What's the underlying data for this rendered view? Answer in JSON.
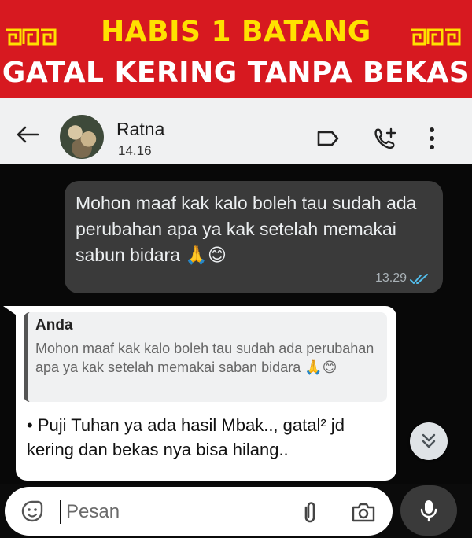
{
  "banner": {
    "line1": "HABIS 1 BATANG",
    "line2": "GATAL KERING TANPA BEKAS",
    "colors": {
      "background": "#d71920",
      "line1": "#ffe100",
      "line2": "#ffffff"
    }
  },
  "header": {
    "contact_name": "Ratna",
    "status": "14.16",
    "icons": [
      "back-arrow-icon",
      "avatar",
      "label-icon",
      "add-call-icon",
      "more-vert-icon"
    ]
  },
  "messages": {
    "outgoing": {
      "text": "Mohon maaf kak kalo boleh tau sudah ada perubahan apa ya kak setelah memakai sabun bidara 🙏😊",
      "time": "13.29",
      "status_icon": "double-check-icon"
    },
    "incoming": {
      "quote_author": "Anda",
      "quote_text": "Mohon maaf kak kalo boleh tau sudah ada perubahan apa ya kak setelah memakai saban bidara 🙏😊",
      "text": "• Puji Tuhan ya ada hasil Mbak.., gatal² jd kering dan bekas nya bisa hilang.."
    }
  },
  "composer": {
    "placeholder": "Pesan",
    "icons": [
      "emoji-icon",
      "attach-icon",
      "camera-icon",
      "mic-icon"
    ]
  }
}
